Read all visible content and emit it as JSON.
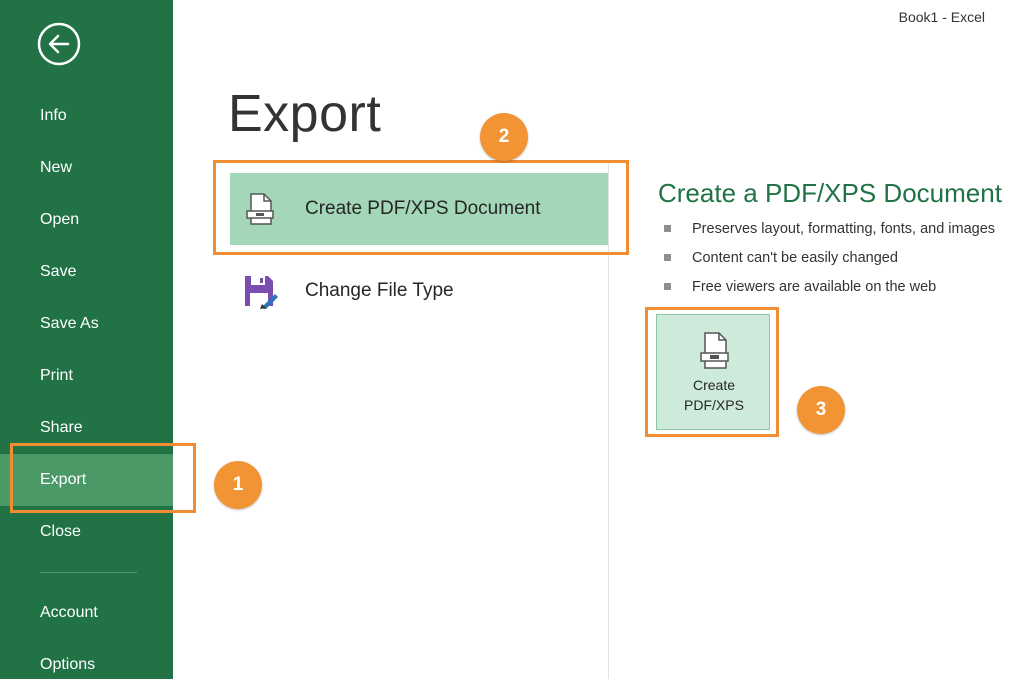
{
  "window": {
    "title": "Book1 - Excel"
  },
  "sidebar": {
    "back_icon": "back-arrow-icon",
    "items": [
      {
        "label": "Info"
      },
      {
        "label": "New"
      },
      {
        "label": "Open"
      },
      {
        "label": "Save"
      },
      {
        "label": "Save As"
      },
      {
        "label": "Print"
      },
      {
        "label": "Share"
      },
      {
        "label": "Export",
        "active": true
      },
      {
        "label": "Close"
      },
      {
        "label": "Account"
      },
      {
        "label": "Options"
      }
    ],
    "colors": {
      "background": "#217346",
      "active": "#4a9966"
    }
  },
  "main": {
    "title": "Export",
    "options": [
      {
        "label": "Create PDF/XPS Document",
        "icon": "pdf-document-icon",
        "selected": true
      },
      {
        "label": "Change File Type",
        "icon": "save-file-type-icon",
        "selected": false
      }
    ]
  },
  "detail": {
    "title": "Create a PDF/XPS Document",
    "bullets": [
      "Preserves layout, formatting, fonts, and images",
      "Content can't be easily changed",
      "Free viewers are available on the web"
    ],
    "button": {
      "line1": "Create",
      "line2": "PDF/XPS",
      "icon": "pdf-document-icon"
    }
  },
  "callouts": [
    "1",
    "2",
    "3"
  ],
  "colors": {
    "accent": "#217346",
    "callout": "#f39434",
    "selected": "#a3d7b7"
  }
}
